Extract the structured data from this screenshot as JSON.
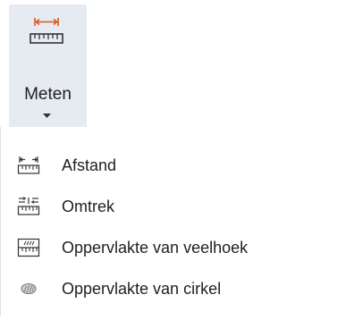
{
  "ribbon": {
    "measure_label": "Meten",
    "accent_color": "#e0561a"
  },
  "menu": {
    "items": [
      {
        "label": "Afstand",
        "icon": "distance-icon"
      },
      {
        "label": "Omtrek",
        "icon": "perimeter-icon"
      },
      {
        "label": "Oppervlakte van veelhoek",
        "icon": "polygon-area-icon"
      },
      {
        "label": "Oppervlakte van cirkel",
        "icon": "circle-area-icon"
      }
    ]
  }
}
